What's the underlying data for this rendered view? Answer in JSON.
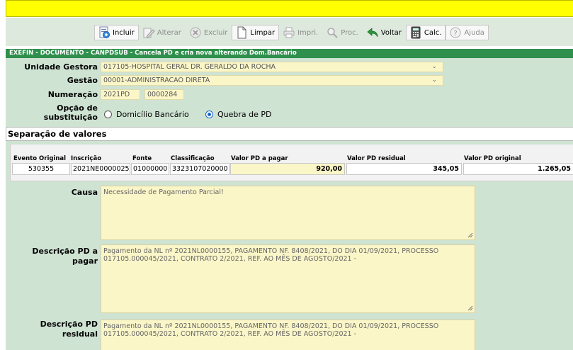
{
  "toolbar": {
    "items": [
      {
        "label": "Incluir",
        "icon": "document-add-icon",
        "enabled": true
      },
      {
        "label": "Alterar",
        "icon": "edit-icon",
        "enabled": false
      },
      {
        "label": "Excluir",
        "icon": "delete-icon",
        "enabled": false
      },
      {
        "label": "Limpar",
        "icon": "clear-icon",
        "enabled": true
      },
      {
        "label": "Impri.",
        "icon": "print-icon",
        "enabled": false
      },
      {
        "label": "Proc.",
        "icon": "search-icon",
        "enabled": false
      },
      {
        "label": "Voltar",
        "icon": "back-arrow-icon",
        "enabled": true
      },
      {
        "label": "Calc.",
        "icon": "calculator-icon",
        "enabled": true
      },
      {
        "label": "Ajuda",
        "icon": "help-icon",
        "enabled": false
      }
    ]
  },
  "panel": {
    "title": "EXEFIN - DOCUMENTO - CANPDSUB - Cancela PD e cria nova alterando Dom.Bancário"
  },
  "form": {
    "unidade_gestora_label": "Unidade Gestora",
    "unidade_gestora_value": "017105-HOSPITAL GERAL DR. GERALDO DA ROCHA",
    "gestao_label": "Gestão",
    "gestao_value": "00001-ADMINISTRACAO DIRETA",
    "numeracao_label": "Numeração",
    "numeracao_year": "2021PD",
    "numeracao_number": "0000284",
    "opcao_label_1": "Opção de",
    "opcao_label_2": "substituição",
    "opcao_1": "Domicílio Bancário",
    "opcao_2": "Quebra de PD",
    "opcao_selected": "Quebra de PD"
  },
  "separacao": {
    "title": "Separação de valores",
    "headers": [
      "Evento Original",
      "Inscrição",
      "Fonte",
      "Classificação",
      "Valor PD a pagar",
      "Valor PD residual",
      "Valor PD original"
    ],
    "row": {
      "evento": "530355",
      "inscricao": "2021NE0000025",
      "fonte": "01000000",
      "classificacao": "3323107020000",
      "valor_pagar": "920,00",
      "valor_residual": "345,05",
      "valor_original": "1.265,05"
    }
  },
  "causa": {
    "label": "Causa",
    "value": "Necessidade de Pagamento Parcial!"
  },
  "descricao_pagar": {
    "label_1": "Descrição PD a",
    "label_2": "pagar",
    "line_1": "Pagamento da NL nº 2021NL0000155, PAGAMENTO NF. 8408/2021, DO DIA 01/09/2021, PROCESSO",
    "line_2": "017105.000045/2021, CONTRATO 2/2021, REF. AO MÊS DE AGOSTO/2021 -"
  },
  "descricao_residual": {
    "label_1": "Descrição PD",
    "label_2": "residual",
    "line_1": "Pagamento da NL nº 2021NL0000155, PAGAMENTO NF. 8408/2021, DO DIA 01/09/2021, PROCESSO",
    "line_2": "017105.000045/2021, CONTRATO 2/2021, REF. AO MÊS DE AGOSTO/2021 -"
  },
  "colors": {
    "top_bar": "#ffff00",
    "panel_title": "#2f8f4c",
    "panel_bg": "#cfe3d3",
    "field_bg": "#fbf6c8",
    "radio_accent": "#1a66c8"
  }
}
